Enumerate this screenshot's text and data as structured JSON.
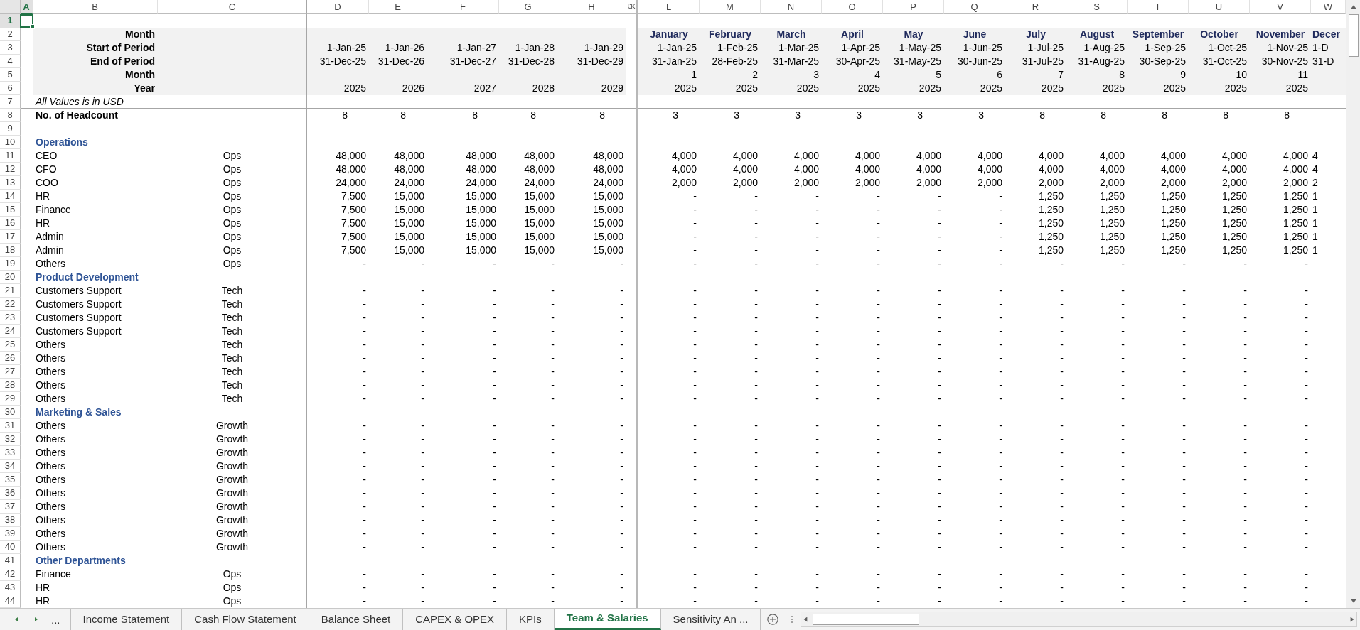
{
  "column_headers": [
    {
      "label": "A",
      "selected": true
    },
    {
      "label": "B",
      "selected": false
    },
    {
      "label": "C",
      "selected": false
    },
    {
      "label": "D",
      "selected": false
    },
    {
      "label": "E",
      "selected": false
    },
    {
      "label": "F",
      "selected": false
    },
    {
      "label": "G",
      "selected": false
    },
    {
      "label": "H",
      "selected": false
    },
    {
      "label": "IJK",
      "selected": false
    },
    {
      "label": "L",
      "selected": false
    },
    {
      "label": "M",
      "selected": false
    },
    {
      "label": "N",
      "selected": false
    },
    {
      "label": "O",
      "selected": false
    },
    {
      "label": "P",
      "selected": false
    },
    {
      "label": "Q",
      "selected": false
    },
    {
      "label": "R",
      "selected": false
    },
    {
      "label": "S",
      "selected": false
    },
    {
      "label": "T",
      "selected": false
    },
    {
      "label": "U",
      "selected": false
    },
    {
      "label": "V",
      "selected": false
    },
    {
      "label": "W",
      "selected": false
    }
  ],
  "row_numbers": [
    {
      "label": "1",
      "selected": true
    },
    {
      "label": "2",
      "selected": false
    },
    {
      "label": "3",
      "selected": false
    },
    {
      "label": "4",
      "selected": false
    },
    {
      "label": "5",
      "selected": false
    },
    {
      "label": "6",
      "selected": false
    },
    {
      "label": "7",
      "selected": false
    },
    {
      "label": "8",
      "selected": false
    },
    {
      "label": "9",
      "selected": false
    },
    {
      "label": "10",
      "selected": false
    },
    {
      "label": "11",
      "selected": false
    },
    {
      "label": "12",
      "selected": false
    },
    {
      "label": "13",
      "selected": false
    },
    {
      "label": "14",
      "selected": false
    },
    {
      "label": "15",
      "selected": false
    },
    {
      "label": "16",
      "selected": false
    },
    {
      "label": "17",
      "selected": false
    },
    {
      "label": "18",
      "selected": false
    },
    {
      "label": "19",
      "selected": false
    },
    {
      "label": "20",
      "selected": false
    },
    {
      "label": "21",
      "selected": false
    },
    {
      "label": "22",
      "selected": false
    },
    {
      "label": "23",
      "selected": false
    },
    {
      "label": "24",
      "selected": false
    },
    {
      "label": "25",
      "selected": false
    },
    {
      "label": "26",
      "selected": false
    },
    {
      "label": "27",
      "selected": false
    },
    {
      "label": "28",
      "selected": false
    },
    {
      "label": "29",
      "selected": false
    },
    {
      "label": "30",
      "selected": false
    },
    {
      "label": "31",
      "selected": false
    },
    {
      "label": "32",
      "selected": false
    },
    {
      "label": "33",
      "selected": false
    },
    {
      "label": "34",
      "selected": false
    },
    {
      "label": "35",
      "selected": false
    },
    {
      "label": "36",
      "selected": false
    },
    {
      "label": "37",
      "selected": false
    },
    {
      "label": "38",
      "selected": false
    },
    {
      "label": "39",
      "selected": false
    },
    {
      "label": "40",
      "selected": false
    },
    {
      "label": "41",
      "selected": false
    },
    {
      "label": "42",
      "selected": false
    },
    {
      "label": "43",
      "selected": false
    },
    {
      "label": "44",
      "selected": false
    }
  ],
  "period_header": {
    "labels": [
      "Month",
      "Start of Period",
      "End of Period",
      "Month",
      "Year"
    ],
    "annual": [
      {
        "start": "1-Jan-25",
        "end": "31-Dec-25",
        "year": "2025"
      },
      {
        "start": "1-Jan-26",
        "end": "31-Dec-26",
        "year": "2026"
      },
      {
        "start": "1-Jan-27",
        "end": "31-Dec-27",
        "year": "2027"
      },
      {
        "start": "1-Jan-28",
        "end": "31-Dec-28",
        "year": "2028"
      },
      {
        "start": "1-Jan-29",
        "end": "31-Dec-29",
        "year": "2029"
      }
    ],
    "monthly": [
      {
        "month": "January",
        "start": "1-Jan-25",
        "end": "31-Jan-25",
        "number": "1",
        "year": "2025"
      },
      {
        "month": "February",
        "start": "1-Feb-25",
        "end": "28-Feb-25",
        "number": "2",
        "year": "2025"
      },
      {
        "month": "March",
        "start": "1-Mar-25",
        "end": "31-Mar-25",
        "number": "3",
        "year": "2025"
      },
      {
        "month": "April",
        "start": "1-Apr-25",
        "end": "30-Apr-25",
        "number": "4",
        "year": "2025"
      },
      {
        "month": "May",
        "start": "1-May-25",
        "end": "31-May-25",
        "number": "5",
        "year": "2025"
      },
      {
        "month": "June",
        "start": "1-Jun-25",
        "end": "30-Jun-25",
        "number": "6",
        "year": "2025"
      },
      {
        "month": "July",
        "start": "1-Jul-25",
        "end": "31-Jul-25",
        "number": "7",
        "year": "2025"
      },
      {
        "month": "August",
        "start": "1-Aug-25",
        "end": "31-Aug-25",
        "number": "8",
        "year": "2025"
      },
      {
        "month": "September",
        "start": "1-Sep-25",
        "end": "30-Sep-25",
        "number": "9",
        "year": "2025"
      },
      {
        "month": "October",
        "start": "1-Oct-25",
        "end": "31-Oct-25",
        "number": "10",
        "year": "2025"
      },
      {
        "month": "November",
        "start": "1-Nov-25",
        "end": "30-Nov-25",
        "number": "11",
        "year": "2025"
      }
    ],
    "column_w": {
      "month": "Decer",
      "start": "1-D",
      "end": "31-D"
    }
  },
  "note": "All Values is in USD",
  "headcount": {
    "label": "No. of Headcount",
    "annual": [
      "8",
      "8",
      "8",
      "8",
      "8"
    ],
    "monthly": [
      "3",
      "3",
      "3",
      "3",
      "3",
      "3",
      "8",
      "8",
      "8",
      "8",
      "8"
    ]
  },
  "sections": [
    {
      "title": "Operations",
      "rows": [
        {
          "name": "CEO",
          "group": "Ops",
          "annual": [
            "48,000",
            "48,000",
            "48,000",
            "48,000",
            "48,000"
          ],
          "monthly": [
            "4,000",
            "4,000",
            "4,000",
            "4,000",
            "4,000",
            "4,000",
            "4,000",
            "4,000",
            "4,000",
            "4,000",
            "4,000"
          ],
          "column_w": "4"
        },
        {
          "name": "CFO",
          "group": "Ops",
          "annual": [
            "48,000",
            "48,000",
            "48,000",
            "48,000",
            "48,000"
          ],
          "monthly": [
            "4,000",
            "4,000",
            "4,000",
            "4,000",
            "4,000",
            "4,000",
            "4,000",
            "4,000",
            "4,000",
            "4,000",
            "4,000"
          ],
          "column_w": "4"
        },
        {
          "name": "COO",
          "group": "Ops",
          "annual": [
            "24,000",
            "24,000",
            "24,000",
            "24,000",
            "24,000"
          ],
          "monthly": [
            "2,000",
            "2,000",
            "2,000",
            "2,000",
            "2,000",
            "2,000",
            "2,000",
            "2,000",
            "2,000",
            "2,000",
            "2,000"
          ],
          "column_w": "2"
        },
        {
          "name": "HR",
          "group": "Ops",
          "annual": [
            "7,500",
            "15,000",
            "15,000",
            "15,000",
            "15,000"
          ],
          "monthly": [
            "-",
            "-",
            "-",
            "-",
            "-",
            "-",
            "1,250",
            "1,250",
            "1,250",
            "1,250",
            "1,250"
          ],
          "column_w": "1"
        },
        {
          "name": "Finance",
          "group": "Ops",
          "annual": [
            "7,500",
            "15,000",
            "15,000",
            "15,000",
            "15,000"
          ],
          "monthly": [
            "-",
            "-",
            "-",
            "-",
            "-",
            "-",
            "1,250",
            "1,250",
            "1,250",
            "1,250",
            "1,250"
          ],
          "column_w": "1"
        },
        {
          "name": "HR",
          "group": "Ops",
          "annual": [
            "7,500",
            "15,000",
            "15,000",
            "15,000",
            "15,000"
          ],
          "monthly": [
            "-",
            "-",
            "-",
            "-",
            "-",
            "-",
            "1,250",
            "1,250",
            "1,250",
            "1,250",
            "1,250"
          ],
          "column_w": "1"
        },
        {
          "name": "Admin",
          "group": "Ops",
          "annual": [
            "7,500",
            "15,000",
            "15,000",
            "15,000",
            "15,000"
          ],
          "monthly": [
            "-",
            "-",
            "-",
            "-",
            "-",
            "-",
            "1,250",
            "1,250",
            "1,250",
            "1,250",
            "1,250"
          ],
          "column_w": "1"
        },
        {
          "name": "Admin",
          "group": "Ops",
          "annual": [
            "7,500",
            "15,000",
            "15,000",
            "15,000",
            "15,000"
          ],
          "monthly": [
            "-",
            "-",
            "-",
            "-",
            "-",
            "-",
            "1,250",
            "1,250",
            "1,250",
            "1,250",
            "1,250"
          ],
          "column_w": "1"
        },
        {
          "name": "Others",
          "group": "Ops",
          "annual": [
            "-",
            "-",
            "-",
            "-",
            "-"
          ],
          "monthly": [
            "-",
            "-",
            "-",
            "-",
            "-",
            "-",
            "-",
            "-",
            "-",
            "-",
            "-"
          ]
        }
      ]
    },
    {
      "title": "Product Development",
      "rows": [
        {
          "name": "Customers Support",
          "group": "Tech",
          "annual": [
            "-",
            "-",
            "-",
            "-",
            "-"
          ],
          "monthly": [
            "-",
            "-",
            "-",
            "-",
            "-",
            "-",
            "-",
            "-",
            "-",
            "-",
            "-"
          ]
        },
        {
          "name": "Customers Support",
          "group": "Tech",
          "annual": [
            "-",
            "-",
            "-",
            "-",
            "-"
          ],
          "monthly": [
            "-",
            "-",
            "-",
            "-",
            "-",
            "-",
            "-",
            "-",
            "-",
            "-",
            "-"
          ]
        },
        {
          "name": "Customers Support",
          "group": "Tech",
          "annual": [
            "-",
            "-",
            "-",
            "-",
            "-"
          ],
          "monthly": [
            "-",
            "-",
            "-",
            "-",
            "-",
            "-",
            "-",
            "-",
            "-",
            "-",
            "-"
          ]
        },
        {
          "name": "Customers Support",
          "group": "Tech",
          "annual": [
            "-",
            "-",
            "-",
            "-",
            "-"
          ],
          "monthly": [
            "-",
            "-",
            "-",
            "-",
            "-",
            "-",
            "-",
            "-",
            "-",
            "-",
            "-"
          ]
        },
        {
          "name": "Others",
          "group": "Tech",
          "annual": [
            "-",
            "-",
            "-",
            "-",
            "-"
          ],
          "monthly": [
            "-",
            "-",
            "-",
            "-",
            "-",
            "-",
            "-",
            "-",
            "-",
            "-",
            "-"
          ]
        },
        {
          "name": "Others",
          "group": "Tech",
          "annual": [
            "-",
            "-",
            "-",
            "-",
            "-"
          ],
          "monthly": [
            "-",
            "-",
            "-",
            "-",
            "-",
            "-",
            "-",
            "-",
            "-",
            "-",
            "-"
          ]
        },
        {
          "name": "Others",
          "group": "Tech",
          "annual": [
            "-",
            "-",
            "-",
            "-",
            "-"
          ],
          "monthly": [
            "-",
            "-",
            "-",
            "-",
            "-",
            "-",
            "-",
            "-",
            "-",
            "-",
            "-"
          ]
        },
        {
          "name": "Others",
          "group": "Tech",
          "annual": [
            "-",
            "-",
            "-",
            "-",
            "-"
          ],
          "monthly": [
            "-",
            "-",
            "-",
            "-",
            "-",
            "-",
            "-",
            "-",
            "-",
            "-",
            "-"
          ]
        },
        {
          "name": "Others",
          "group": "Tech",
          "annual": [
            "-",
            "-",
            "-",
            "-",
            "-"
          ],
          "monthly": [
            "-",
            "-",
            "-",
            "-",
            "-",
            "-",
            "-",
            "-",
            "-",
            "-",
            "-"
          ]
        }
      ]
    },
    {
      "title": "Marketing & Sales",
      "rows": [
        {
          "name": "Others",
          "group": "Growth",
          "annual": [
            "-",
            "-",
            "-",
            "-",
            "-"
          ],
          "monthly": [
            "-",
            "-",
            "-",
            "-",
            "-",
            "-",
            "-",
            "-",
            "-",
            "-",
            "-"
          ]
        },
        {
          "name": "Others",
          "group": "Growth",
          "annual": [
            "-",
            "-",
            "-",
            "-",
            "-"
          ],
          "monthly": [
            "-",
            "-",
            "-",
            "-",
            "-",
            "-",
            "-",
            "-",
            "-",
            "-",
            "-"
          ]
        },
        {
          "name": "Others",
          "group": "Growth",
          "annual": [
            "-",
            "-",
            "-",
            "-",
            "-"
          ],
          "monthly": [
            "-",
            "-",
            "-",
            "-",
            "-",
            "-",
            "-",
            "-",
            "-",
            "-",
            "-"
          ]
        },
        {
          "name": "Others",
          "group": "Growth",
          "annual": [
            "-",
            "-",
            "-",
            "-",
            "-"
          ],
          "monthly": [
            "-",
            "-",
            "-",
            "-",
            "-",
            "-",
            "-",
            "-",
            "-",
            "-",
            "-"
          ]
        },
        {
          "name": "Others",
          "group": "Growth",
          "annual": [
            "-",
            "-",
            "-",
            "-",
            "-"
          ],
          "monthly": [
            "-",
            "-",
            "-",
            "-",
            "-",
            "-",
            "-",
            "-",
            "-",
            "-",
            "-"
          ]
        },
        {
          "name": "Others",
          "group": "Growth",
          "annual": [
            "-",
            "-",
            "-",
            "-",
            "-"
          ],
          "monthly": [
            "-",
            "-",
            "-",
            "-",
            "-",
            "-",
            "-",
            "-",
            "-",
            "-",
            "-"
          ]
        },
        {
          "name": "Others",
          "group": "Growth",
          "annual": [
            "-",
            "-",
            "-",
            "-",
            "-"
          ],
          "monthly": [
            "-",
            "-",
            "-",
            "-",
            "-",
            "-",
            "-",
            "-",
            "-",
            "-",
            "-"
          ]
        },
        {
          "name": "Others",
          "group": "Growth",
          "annual": [
            "-",
            "-",
            "-",
            "-",
            "-"
          ],
          "monthly": [
            "-",
            "-",
            "-",
            "-",
            "-",
            "-",
            "-",
            "-",
            "-",
            "-",
            "-"
          ]
        },
        {
          "name": "Others",
          "group": "Growth",
          "annual": [
            "-",
            "-",
            "-",
            "-",
            "-"
          ],
          "monthly": [
            "-",
            "-",
            "-",
            "-",
            "-",
            "-",
            "-",
            "-",
            "-",
            "-",
            "-"
          ]
        },
        {
          "name": "Others",
          "group": "Growth",
          "annual": [
            "-",
            "-",
            "-",
            "-",
            "-"
          ],
          "monthly": [
            "-",
            "-",
            "-",
            "-",
            "-",
            "-",
            "-",
            "-",
            "-",
            "-",
            "-"
          ]
        }
      ]
    },
    {
      "title": "Other Departments",
      "rows": [
        {
          "name": "Finance",
          "group": "Ops",
          "annual": [
            "-",
            "-",
            "-",
            "-",
            "-"
          ],
          "monthly": [
            "-",
            "-",
            "-",
            "-",
            "-",
            "-",
            "-",
            "-",
            "-",
            "-",
            "-"
          ]
        },
        {
          "name": "HR",
          "group": "Ops",
          "annual": [
            "-",
            "-",
            "-",
            "-",
            "-"
          ],
          "monthly": [
            "-",
            "-",
            "-",
            "-",
            "-",
            "-",
            "-",
            "-",
            "-",
            "-",
            "-"
          ]
        },
        {
          "name": "HR",
          "group": "Ops",
          "annual": [
            "-",
            "-",
            "-",
            "-",
            "-"
          ],
          "monthly": [
            "-",
            "-",
            "-",
            "-",
            "-",
            "-",
            "-",
            "-",
            "-",
            "-",
            "-"
          ]
        }
      ]
    }
  ],
  "tab_overflow": "...",
  "sheet_tabs": [
    {
      "label": "Income Statement",
      "selected": false
    },
    {
      "label": "Cash Flow Statement",
      "selected": false
    },
    {
      "label": "Balance Sheet",
      "selected": false
    },
    {
      "label": "CAPEX & OPEX",
      "selected": false
    },
    {
      "label": "KPIs",
      "selected": false
    },
    {
      "label": "Team & Salaries",
      "selected": true
    },
    {
      "label": "Sensitivity An ...",
      "selected": false
    }
  ]
}
